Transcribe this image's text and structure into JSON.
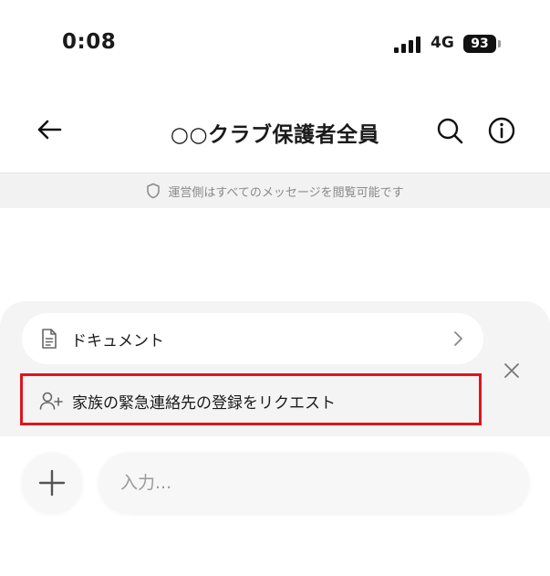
{
  "status_bar": {
    "time": "0:08",
    "network": "4G",
    "battery": "93"
  },
  "header": {
    "title": "○○クラブ保護者全員",
    "back_icon": "arrow-left-icon",
    "search_icon": "search-icon",
    "info_icon": "info-icon"
  },
  "notice": {
    "text": "運営側はすべてのメッセージを閲覧可能です",
    "icon": "shield-icon"
  },
  "suggestions": {
    "items": [
      {
        "label": "ドキュメント",
        "icon": "document-icon"
      },
      {
        "label": "家族の緊急連絡先の登録をリクエスト",
        "icon": "add-person-icon"
      }
    ],
    "highlight_color": "#e0151b"
  },
  "composer": {
    "placeholder": "入力..."
  }
}
